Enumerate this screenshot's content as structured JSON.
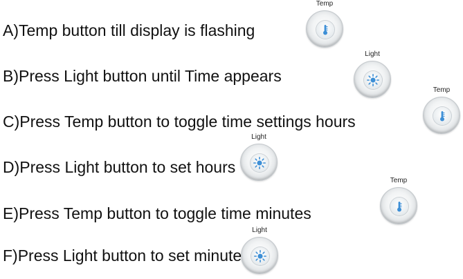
{
  "steps": [
    {
      "text": "A)Temp button till display is flashing",
      "button": {
        "caption": "Temp",
        "icon": "thermometer-icon"
      }
    },
    {
      "text": "B)Press Light button until Time appears",
      "button": {
        "caption": "Light",
        "icon": "sun-icon"
      }
    },
    {
      "text": "C)Press Temp button to toggle time settings hours",
      "button": {
        "caption": "Temp",
        "icon": "thermometer-icon"
      }
    },
    {
      "text": "D)Press Light button to set hours",
      "button": {
        "caption": "Light",
        "icon": "sun-icon"
      }
    },
    {
      "text": "E)Press Temp button to toggle time minutes",
      "button": {
        "caption": "Temp",
        "icon": "thermometer-icon"
      }
    },
    {
      "text": "F)Press Light button to set minutes",
      "button": {
        "caption": "Light",
        "icon": "sun-icon"
      }
    }
  ],
  "colors": {
    "text": "#111111",
    "icon_blue": "#3d8fd6",
    "button_rim": "#c2c7cb"
  }
}
